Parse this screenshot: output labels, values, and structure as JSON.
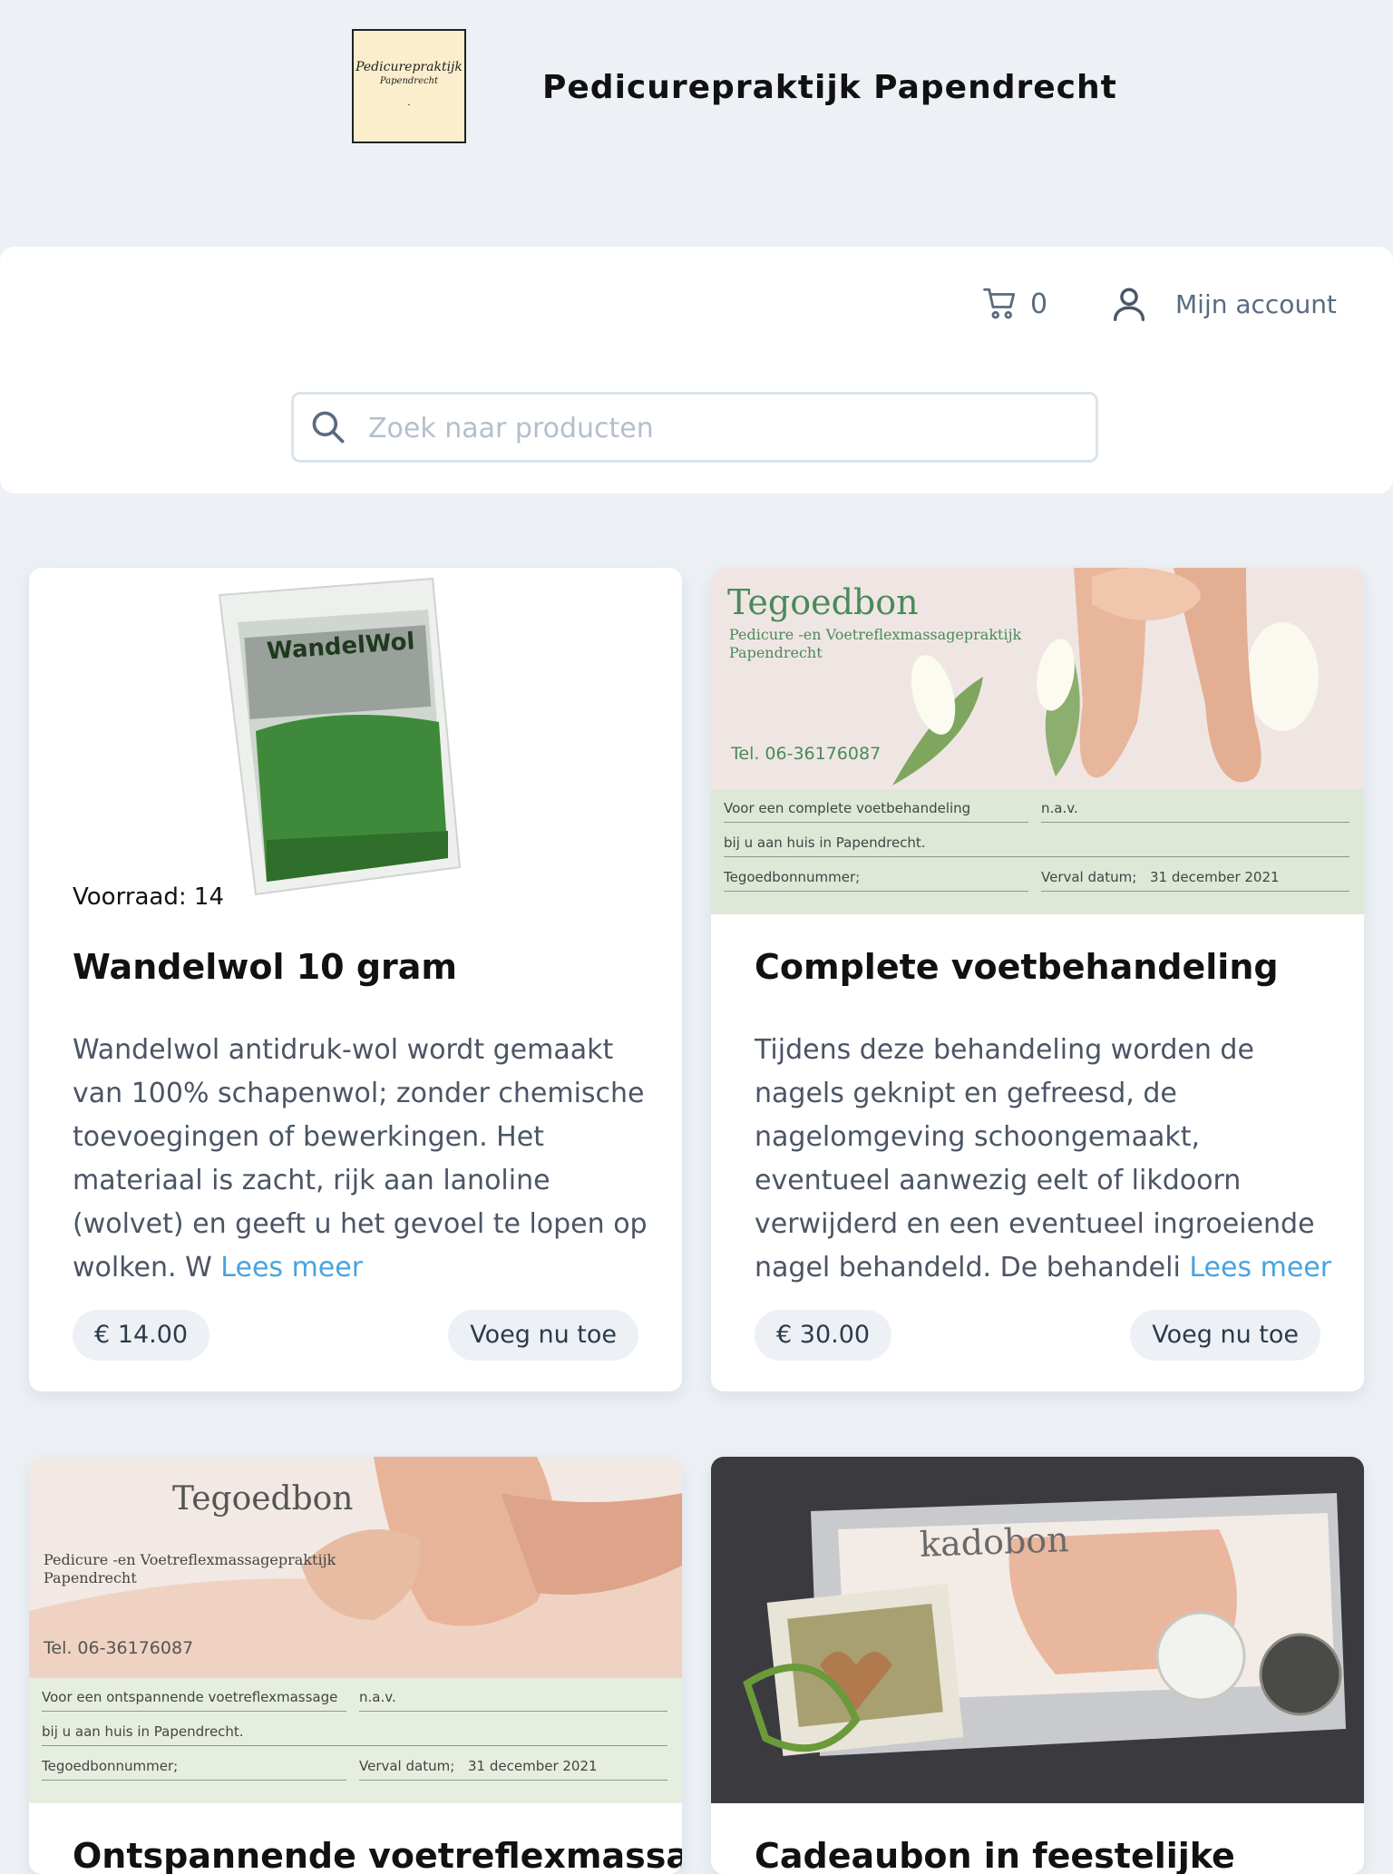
{
  "header": {
    "logo_text_1": "Pedicurepraktijk",
    "logo_text_2": "Papendrecht",
    "site_title": "Pedicurepraktijk Papendrecht"
  },
  "topbar": {
    "cart_count": "0",
    "account_label": "Mijn account",
    "search_placeholder": "Zoek naar producten"
  },
  "products": [
    {
      "stock": "Voorraad: 14",
      "title": "Wandelwol 10 gram",
      "description": "Wandelwol antidruk-wol wordt gemaakt van 100% schapenwol; zonder chemische toevoegingen of bewerkingen. Het materiaal is zacht, rijk aan lanoline (wolvet) en geeft u het gevoel te lopen op wolken. W",
      "more": "Lees meer",
      "price": "€ 14.00",
      "add": "Voeg nu toe",
      "image_text": "WandelWol"
    },
    {
      "title": "Complete voetbehandeling",
      "description": "Tijdens deze behandeling worden de nagels geknipt en gefreesd, de nagelomgeving schoongemaakt, eventueel aanwezig eelt of likdoorn verwijderd en een eventueel ingroeiende nagel behandeld. De behandeli",
      "more": "Lees meer",
      "price": "€ 30.00",
      "add": "Voeg nu toe",
      "voucher": {
        "title": "Tegoedbon",
        "sub1": "Pedicure -en Voetreflexmassagepraktijk",
        "sub2": "Papendrecht",
        "tel": "Tel. 06-36176087",
        "line1": "Voor een complete voetbehandeling",
        "nav": "n.a.v.",
        "line2": "bij u aan huis in Papendrecht.",
        "line3": "Tegoedbonnummer;",
        "verval": "Verval datum;",
        "date": "31 december 2021"
      }
    },
    {
      "title": "Ontspannende voetreflexmassage",
      "voucher": {
        "title": "Tegoedbon",
        "sub1": "Pedicure -en Voetreflexmassagepraktijk",
        "sub2": "Papendrecht",
        "tel": "Tel. 06-36176087",
        "line1": "Voor een ontspannende voetreflexmassage",
        "nav": "n.a.v.",
        "line2": "bij u aan huis in Papendrecht.",
        "line3": "Tegoedbonnummer;",
        "verval": "Verval datum;",
        "date": "31 december 2021"
      }
    },
    {
      "title": "Cadeaubon in feestelijke",
      "image_text": "kadobon"
    }
  ]
}
